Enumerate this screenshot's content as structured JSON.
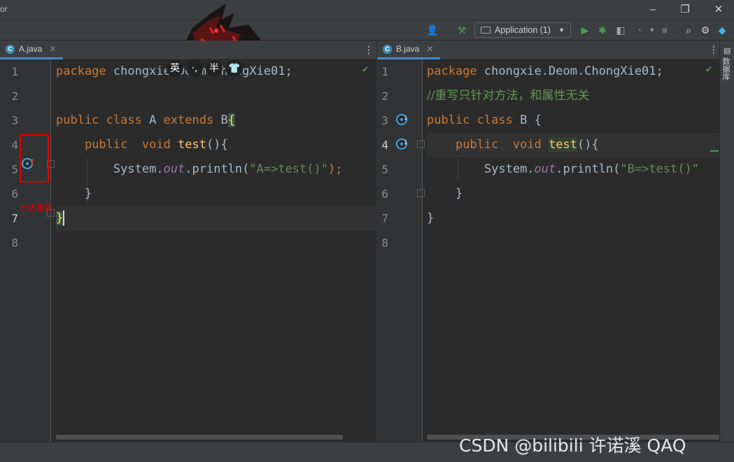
{
  "window": {
    "title": "or"
  },
  "toolbar": {
    "run_config": "Application (1)"
  },
  "left_editor": {
    "tab": "A.java",
    "line_numbers": [
      "1",
      "2",
      "3",
      "4",
      "5",
      "6",
      "7",
      "8"
    ],
    "code": {
      "l1_kw": "package",
      "l1_rest": " chongxie.Deom.ChongXie01;",
      "l3_kw1": "public",
      "l3_kw2": "class",
      "l3_name": " A ",
      "l3_kw3": "extends",
      "l3_rest": " B",
      "l3_brace": "{",
      "l4_kw1": "public",
      "l4_kw2": "void",
      "l4_fn": "test",
      "l4_rest": "(){",
      "l5_a": "System.",
      "l5_field": "out",
      "l5_b": ".println(",
      "l5_str": "\"A=>test()\"",
      "l5_c": ");",
      "l6": "}",
      "l7": "}"
    },
    "annotation": "代表重载"
  },
  "right_editor": {
    "tab": "B.java",
    "line_numbers": [
      "1",
      "2",
      "3",
      "4",
      "5",
      "6",
      "7",
      "8"
    ],
    "code": {
      "l1_kw": "package",
      "l1_rest": " chongxie.Deom.ChongXie01;",
      "l2_comment": "//重写只针对方法，和属性无关",
      "l3_kw1": "public",
      "l3_kw2": "class",
      "l3_rest": " B {",
      "l4_kw1": "public",
      "l4_kw2": "void",
      "l4_fn": "test",
      "l4_rest": "(){",
      "l5_a": "System.",
      "l5_field": "out",
      "l5_b": ".println(",
      "l5_str": "\"B=>test()\"",
      "l6": "}",
      "l7": "}"
    }
  },
  "ime_toolbar": [
    "英",
    "·,",
    "半",
    "👕"
  ],
  "right_strip_label": "数据库",
  "watermark": "CSDN @bilibili  许诺溪  QAQ",
  "colors": {
    "keyword": "#cc7832",
    "function": "#ffc66d",
    "string": "#6a8759",
    "comment": "#629755",
    "annotation": "#e00000"
  }
}
